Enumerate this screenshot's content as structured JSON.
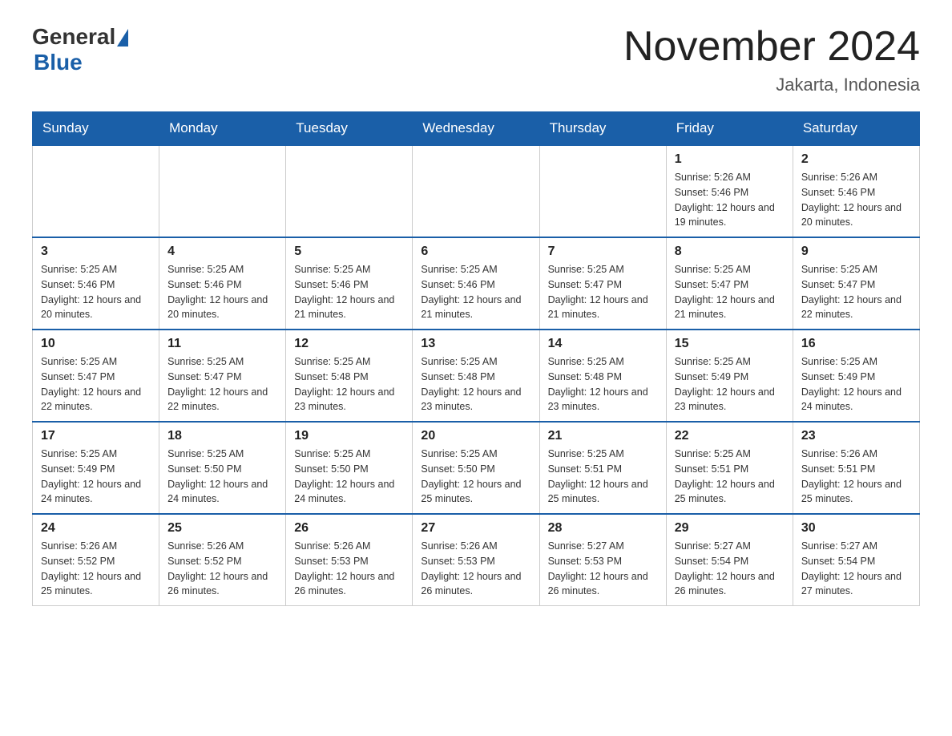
{
  "logo": {
    "general": "General",
    "blue": "Blue"
  },
  "header": {
    "month_year": "November 2024",
    "location": "Jakarta, Indonesia"
  },
  "weekdays": [
    "Sunday",
    "Monday",
    "Tuesday",
    "Wednesday",
    "Thursday",
    "Friday",
    "Saturday"
  ],
  "weeks": [
    [
      {
        "day": "",
        "sunrise": "",
        "sunset": "",
        "daylight": ""
      },
      {
        "day": "",
        "sunrise": "",
        "sunset": "",
        "daylight": ""
      },
      {
        "day": "",
        "sunrise": "",
        "sunset": "",
        "daylight": ""
      },
      {
        "day": "",
        "sunrise": "",
        "sunset": "",
        "daylight": ""
      },
      {
        "day": "",
        "sunrise": "",
        "sunset": "",
        "daylight": ""
      },
      {
        "day": "1",
        "sunrise": "Sunrise: 5:26 AM",
        "sunset": "Sunset: 5:46 PM",
        "daylight": "Daylight: 12 hours and 19 minutes."
      },
      {
        "day": "2",
        "sunrise": "Sunrise: 5:26 AM",
        "sunset": "Sunset: 5:46 PM",
        "daylight": "Daylight: 12 hours and 20 minutes."
      }
    ],
    [
      {
        "day": "3",
        "sunrise": "Sunrise: 5:25 AM",
        "sunset": "Sunset: 5:46 PM",
        "daylight": "Daylight: 12 hours and 20 minutes."
      },
      {
        "day": "4",
        "sunrise": "Sunrise: 5:25 AM",
        "sunset": "Sunset: 5:46 PM",
        "daylight": "Daylight: 12 hours and 20 minutes."
      },
      {
        "day": "5",
        "sunrise": "Sunrise: 5:25 AM",
        "sunset": "Sunset: 5:46 PM",
        "daylight": "Daylight: 12 hours and 21 minutes."
      },
      {
        "day": "6",
        "sunrise": "Sunrise: 5:25 AM",
        "sunset": "Sunset: 5:46 PM",
        "daylight": "Daylight: 12 hours and 21 minutes."
      },
      {
        "day": "7",
        "sunrise": "Sunrise: 5:25 AM",
        "sunset": "Sunset: 5:47 PM",
        "daylight": "Daylight: 12 hours and 21 minutes."
      },
      {
        "day": "8",
        "sunrise": "Sunrise: 5:25 AM",
        "sunset": "Sunset: 5:47 PM",
        "daylight": "Daylight: 12 hours and 21 minutes."
      },
      {
        "day": "9",
        "sunrise": "Sunrise: 5:25 AM",
        "sunset": "Sunset: 5:47 PM",
        "daylight": "Daylight: 12 hours and 22 minutes."
      }
    ],
    [
      {
        "day": "10",
        "sunrise": "Sunrise: 5:25 AM",
        "sunset": "Sunset: 5:47 PM",
        "daylight": "Daylight: 12 hours and 22 minutes."
      },
      {
        "day": "11",
        "sunrise": "Sunrise: 5:25 AM",
        "sunset": "Sunset: 5:47 PM",
        "daylight": "Daylight: 12 hours and 22 minutes."
      },
      {
        "day": "12",
        "sunrise": "Sunrise: 5:25 AM",
        "sunset": "Sunset: 5:48 PM",
        "daylight": "Daylight: 12 hours and 23 minutes."
      },
      {
        "day": "13",
        "sunrise": "Sunrise: 5:25 AM",
        "sunset": "Sunset: 5:48 PM",
        "daylight": "Daylight: 12 hours and 23 minutes."
      },
      {
        "day": "14",
        "sunrise": "Sunrise: 5:25 AM",
        "sunset": "Sunset: 5:48 PM",
        "daylight": "Daylight: 12 hours and 23 minutes."
      },
      {
        "day": "15",
        "sunrise": "Sunrise: 5:25 AM",
        "sunset": "Sunset: 5:49 PM",
        "daylight": "Daylight: 12 hours and 23 minutes."
      },
      {
        "day": "16",
        "sunrise": "Sunrise: 5:25 AM",
        "sunset": "Sunset: 5:49 PM",
        "daylight": "Daylight: 12 hours and 24 minutes."
      }
    ],
    [
      {
        "day": "17",
        "sunrise": "Sunrise: 5:25 AM",
        "sunset": "Sunset: 5:49 PM",
        "daylight": "Daylight: 12 hours and 24 minutes."
      },
      {
        "day": "18",
        "sunrise": "Sunrise: 5:25 AM",
        "sunset": "Sunset: 5:50 PM",
        "daylight": "Daylight: 12 hours and 24 minutes."
      },
      {
        "day": "19",
        "sunrise": "Sunrise: 5:25 AM",
        "sunset": "Sunset: 5:50 PM",
        "daylight": "Daylight: 12 hours and 24 minutes."
      },
      {
        "day": "20",
        "sunrise": "Sunrise: 5:25 AM",
        "sunset": "Sunset: 5:50 PM",
        "daylight": "Daylight: 12 hours and 25 minutes."
      },
      {
        "day": "21",
        "sunrise": "Sunrise: 5:25 AM",
        "sunset": "Sunset: 5:51 PM",
        "daylight": "Daylight: 12 hours and 25 minutes."
      },
      {
        "day": "22",
        "sunrise": "Sunrise: 5:25 AM",
        "sunset": "Sunset: 5:51 PM",
        "daylight": "Daylight: 12 hours and 25 minutes."
      },
      {
        "day": "23",
        "sunrise": "Sunrise: 5:26 AM",
        "sunset": "Sunset: 5:51 PM",
        "daylight": "Daylight: 12 hours and 25 minutes."
      }
    ],
    [
      {
        "day": "24",
        "sunrise": "Sunrise: 5:26 AM",
        "sunset": "Sunset: 5:52 PM",
        "daylight": "Daylight: 12 hours and 25 minutes."
      },
      {
        "day": "25",
        "sunrise": "Sunrise: 5:26 AM",
        "sunset": "Sunset: 5:52 PM",
        "daylight": "Daylight: 12 hours and 26 minutes."
      },
      {
        "day": "26",
        "sunrise": "Sunrise: 5:26 AM",
        "sunset": "Sunset: 5:53 PM",
        "daylight": "Daylight: 12 hours and 26 minutes."
      },
      {
        "day": "27",
        "sunrise": "Sunrise: 5:26 AM",
        "sunset": "Sunset: 5:53 PM",
        "daylight": "Daylight: 12 hours and 26 minutes."
      },
      {
        "day": "28",
        "sunrise": "Sunrise: 5:27 AM",
        "sunset": "Sunset: 5:53 PM",
        "daylight": "Daylight: 12 hours and 26 minutes."
      },
      {
        "day": "29",
        "sunrise": "Sunrise: 5:27 AM",
        "sunset": "Sunset: 5:54 PM",
        "daylight": "Daylight: 12 hours and 26 minutes."
      },
      {
        "day": "30",
        "sunrise": "Sunrise: 5:27 AM",
        "sunset": "Sunset: 5:54 PM",
        "daylight": "Daylight: 12 hours and 27 minutes."
      }
    ]
  ]
}
